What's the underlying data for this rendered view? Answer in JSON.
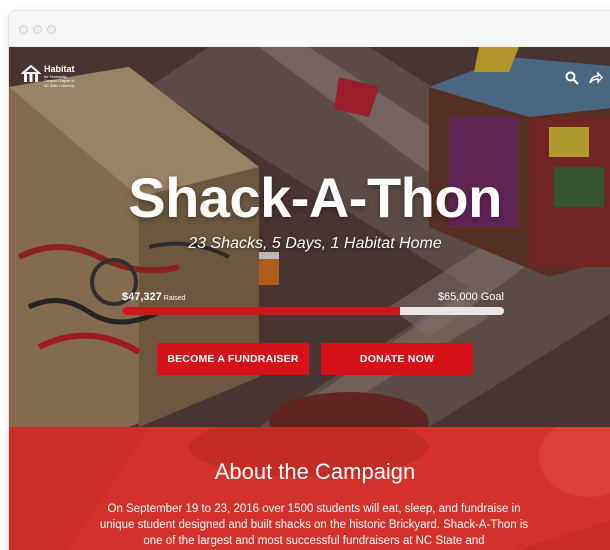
{
  "logo": {
    "line1": "Habitat",
    "line2": "for Humanity",
    "line3": "Campus Chapter of",
    "line4": "NC State University"
  },
  "header": {
    "icons": [
      "search-icon",
      "share-icon",
      "menu-icon"
    ]
  },
  "hero": {
    "title": "Shack-A-Thon",
    "subtitle": "23 Shacks, 5 Days, 1 Habitat Home",
    "raised_amount": "$47,327",
    "raised_label": "Raised",
    "goal": "$65,000 Goal",
    "progress_fraction": 0.728,
    "fundraiser_button": "BECOME A FUNDRAISER",
    "donate_button": "DONATE NOW"
  },
  "about": {
    "heading": "About the Campaign",
    "body": "On September 19 to 23, 2016 over 1500 students will eat, sleep, and fundraise in unique student designed and built shacks on the historic Brickyard. Shack-A-Thon is one of the largest and most successful fundraisers at NC State and"
  },
  "colors": {
    "accent": "#d5121a",
    "about_bg": "#d3322c",
    "bar_track": "#e9e6e6"
  }
}
